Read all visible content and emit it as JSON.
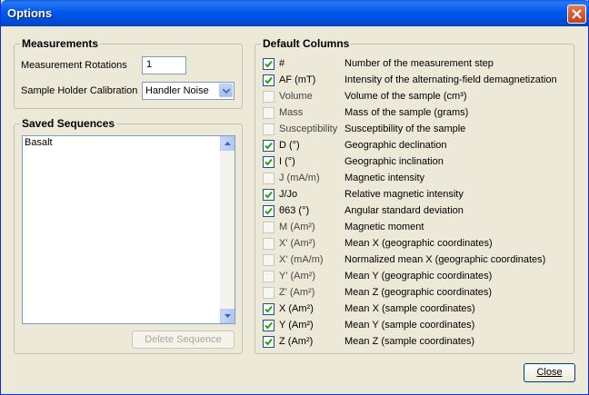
{
  "window": {
    "title": "Options"
  },
  "measurements": {
    "title": "Measurements",
    "rotations_label": "Measurement Rotations",
    "rotations_value": "1",
    "calibration_label": "Sample Holder Calibration",
    "calibration_value": "Handler Noise"
  },
  "sequences": {
    "title": "Saved Sequences",
    "items": [
      "Basalt"
    ],
    "delete_label": "Delete Sequence"
  },
  "columns": {
    "title": "Default Columns",
    "items": [
      {
        "name": "#",
        "desc": "Number of the measurement step",
        "checked": true
      },
      {
        "name": "AF (mT)",
        "desc": "Intensity of the alternating-field demagnetization",
        "checked": true
      },
      {
        "name": "Volume",
        "desc": "Volume of the sample (cm³)",
        "checked": false
      },
      {
        "name": "Mass",
        "desc": "Mass of the sample (grams)",
        "checked": false
      },
      {
        "name": "Susceptibility",
        "desc": "Susceptibility of the sample",
        "checked": false
      },
      {
        "name": "D (°)",
        "desc": "Geographic declination",
        "checked": true
      },
      {
        "name": "I (°)",
        "desc": "Geographic inclination",
        "checked": true
      },
      {
        "name": "J (mA/m)",
        "desc": "Magnetic intensity",
        "checked": false
      },
      {
        "name": "J/Jo",
        "desc": "Relative magnetic intensity",
        "checked": true
      },
      {
        "name": "θ63 (°)",
        "desc": "Angular standard deviation",
        "checked": true
      },
      {
        "name": "M (Am²)",
        "desc": "Magnetic moment",
        "checked": false
      },
      {
        "name": "X' (Am²)",
        "desc": "Mean X (geographic coordinates)",
        "checked": false
      },
      {
        "name": "X' (mA/m)",
        "desc": "Normalized mean X (geographic coordinates)",
        "checked": false
      },
      {
        "name": "Y' (Am²)",
        "desc": "Mean Y (geographic coordinates)",
        "checked": false
      },
      {
        "name": "Z' (Am²)",
        "desc": "Mean Z (geographic coordinates)",
        "checked": false
      },
      {
        "name": "X (Am²)",
        "desc": "Mean X (sample coordinates)",
        "checked": true
      },
      {
        "name": "Y (Am²)",
        "desc": "Mean Y (sample coordinates)",
        "checked": true
      },
      {
        "name": "Z (Am²)",
        "desc": "Mean Z (sample coordinates)",
        "checked": true
      }
    ]
  },
  "footer": {
    "close_label": "Close"
  },
  "colors": {
    "titlebar": "#0058ee",
    "close_button": "#c63f14",
    "dialog_bg": "#ece9d8"
  }
}
